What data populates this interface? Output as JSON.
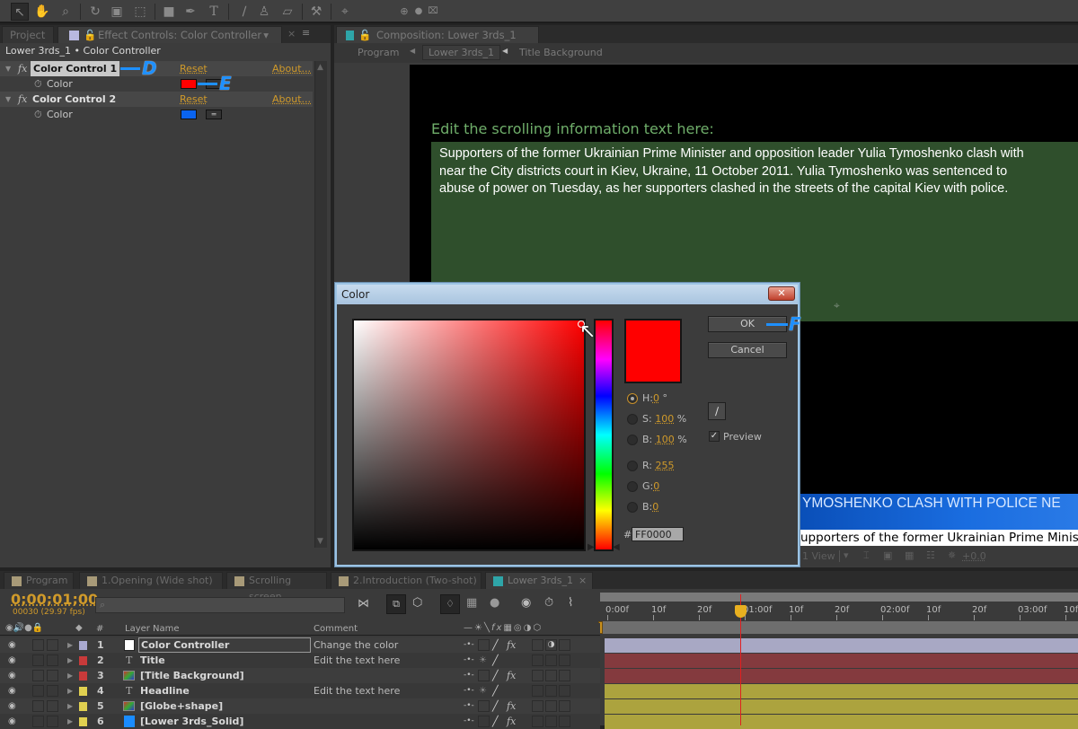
{
  "toolbar": {
    "tools": [
      "selection-tool",
      "hand-tool",
      "zoom-tool",
      "rotation-tool",
      "camera-tool",
      "pan-behind-tool",
      "rectangle-tool",
      "pen-tool",
      "type-tool",
      "brush-tool",
      "clone-stamp-tool",
      "eraser-tool",
      "roto-brush-tool",
      "puppet-pin-tool"
    ]
  },
  "effect_controls": {
    "tab_project": "Project",
    "tab_title": "Effect Controls: Color Controller",
    "breadcrumb": "Lower 3rds_1 • Color Controller",
    "effects": [
      {
        "name": "Color Control 1",
        "reset": "Reset",
        "about": "About...",
        "param": "Color",
        "color": "#ff0000"
      },
      {
        "name": "Color Control 2",
        "reset": "Reset",
        "about": "About...",
        "param": "Color",
        "color": "#0a64f0"
      }
    ],
    "annotations": {
      "d": "D",
      "e": "E",
      "f": "F"
    }
  },
  "composition": {
    "tab_title": "Composition: Lower 3rds_1",
    "breadcrumbs": [
      "Program",
      "Lower 3rds_1",
      "Title Background"
    ],
    "heading": "Edit the scrolling information text here:",
    "body_text": "Supporters of the former Ukrainian Prime Minister and opposition leader Yulia Tymoshenko clash with near the City districts court in Kiev, Ukraine, 11 October 2011. Yulia Tymoshenko was sentenced to abuse of power on Tuesday, as her supporters clashed in the streets of the capital Kiev with police.",
    "body_lines": [
      "Supporters of the former Ukrainian Prime Minister and opposition leader Yulia Tymoshenko clash with",
      "near the City districts court in Kiev, Ukraine, 11 October 2011. Yulia Tymoshenko was sentenced to",
      "abuse of power on Tuesday, as her supporters clashed in the streets of the capital Kiev with police."
    ],
    "headline_banner": "YMOSHENKO CLASH WITH POLICE NE",
    "ticker_text": "upporters of the former Ukrainian Prime Minist",
    "view_label": "1 View",
    "exposure": "+0.0"
  },
  "color_dialog": {
    "title": "Color",
    "close": "✕",
    "ok": "OK",
    "cancel": "Cancel",
    "fields": [
      {
        "label": "H:",
        "value": "0",
        "unit": "°",
        "selected": true
      },
      {
        "label": "S:",
        "value": "100",
        "unit": "%",
        "selected": false
      },
      {
        "label": "B:",
        "value": "100",
        "unit": "%",
        "selected": false
      },
      {
        "label": "R:",
        "value": "255",
        "unit": "",
        "selected": false
      },
      {
        "label": "G:",
        "value": "0",
        "unit": "",
        "selected": false
      },
      {
        "label": "B:",
        "value": "0",
        "unit": "",
        "selected": false
      }
    ],
    "hex_label": "#",
    "hex_value": "FF0000",
    "preview_label": "Preview",
    "preview_checked": true,
    "current_color": "#ff0000"
  },
  "timeline": {
    "tabs": [
      {
        "label": "Program",
        "color": "#a89a78"
      },
      {
        "label": "1.Opening (Wide shot)",
        "color": "#a89a78"
      },
      {
        "label": "Scrolling screen",
        "color": "#a89a78"
      },
      {
        "label": "2.Introduction (Two-shot)",
        "color": "#a89a78"
      },
      {
        "label": "Lower 3rds_1",
        "color": "#2ea5a8",
        "active": true
      }
    ],
    "timecode": "0;00;01;00",
    "frame_info": "00030 (29.97 fps)",
    "search_placeholder": "",
    "columns": {
      "num": "#",
      "layer_name": "Layer Name",
      "comment": "Comment"
    },
    "ruler_ticks": [
      "0:00f",
      "10f",
      "20f",
      "01:00f",
      "10f",
      "20f",
      "02:00f",
      "10f",
      "20f",
      "03:00f",
      "10f"
    ],
    "layers": [
      {
        "num": "1",
        "name": "Color Controller",
        "comment": "Change the color",
        "label_color": "#a9a9d0",
        "type": "solid-white",
        "fx": true,
        "bar_color": "#a8a8c4"
      },
      {
        "num": "2",
        "name": "Title",
        "comment": "Edit the text here",
        "label_color": "#c83a3a",
        "type": "text",
        "fx": false,
        "bar_color": "#843a3e"
      },
      {
        "num": "3",
        "name": "[Title Background]",
        "comment": "",
        "label_color": "#c83a3a",
        "type": "precomp",
        "fx": true,
        "bar_color": "#843a3e"
      },
      {
        "num": "4",
        "name": "Headline",
        "comment": "Edit the text here",
        "label_color": "#e0d050",
        "type": "text",
        "fx": false,
        "bar_color": "#aca33e"
      },
      {
        "num": "5",
        "name": "[Globe+shape]",
        "comment": "",
        "label_color": "#e0d050",
        "type": "precomp",
        "fx": true,
        "bar_color": "#aca33e"
      },
      {
        "num": "6",
        "name": "[Lower 3rds_Solid]",
        "comment": "",
        "label_color": "#e0d050",
        "type": "solid-blue",
        "fx": true,
        "bar_color": "#aca33e"
      }
    ]
  }
}
